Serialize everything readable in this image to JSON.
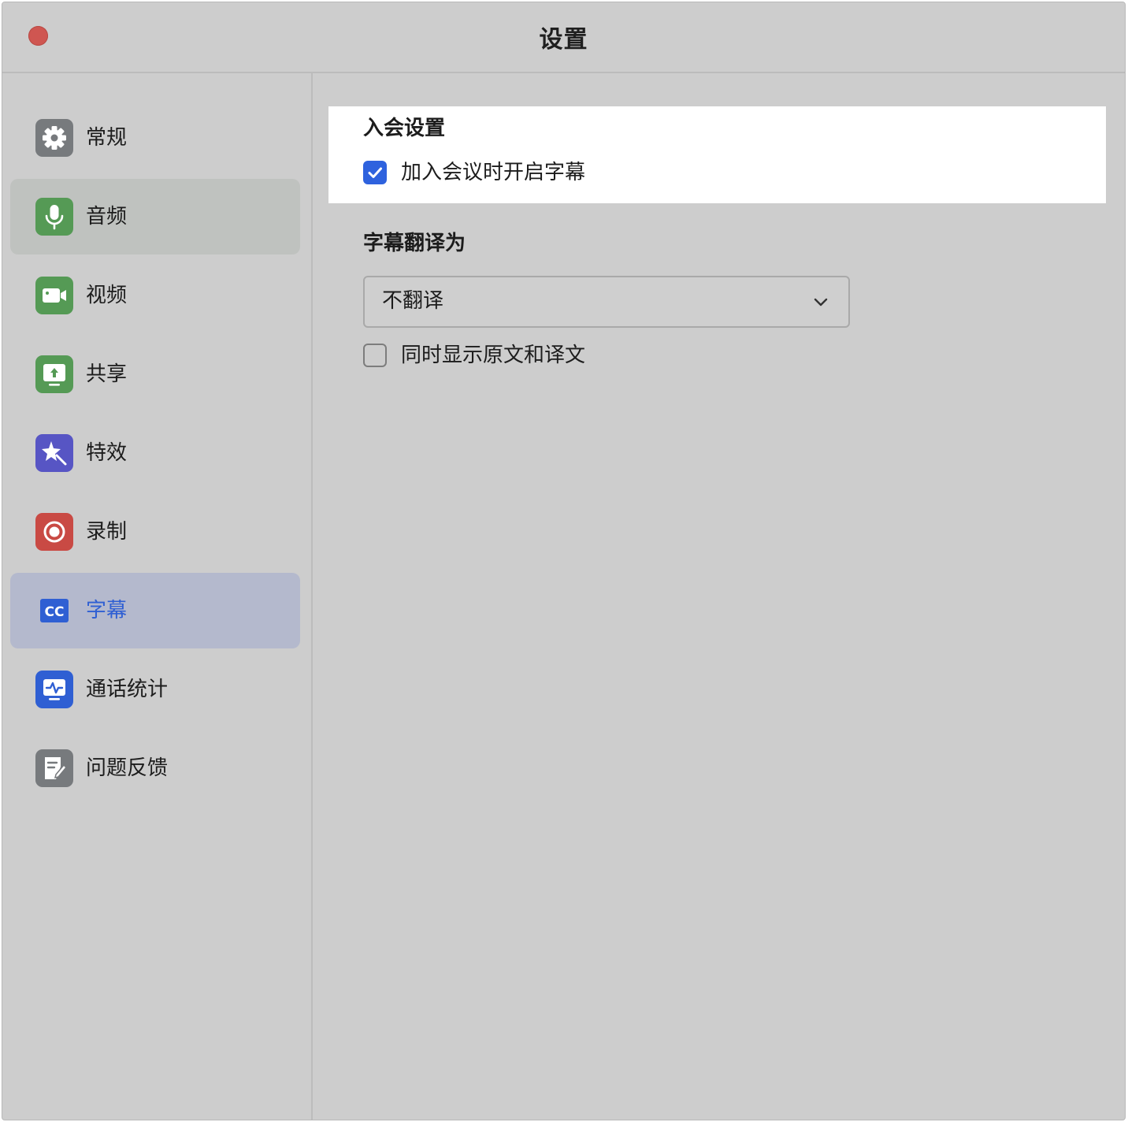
{
  "window": {
    "title": "设置"
  },
  "sidebar": {
    "items": [
      {
        "label": "常规",
        "icon": "gear-icon",
        "color": "#777a7d",
        "state": "normal"
      },
      {
        "label": "音频",
        "icon": "microphone-icon",
        "color": "#559a55",
        "state": "hover"
      },
      {
        "label": "视频",
        "icon": "video-camera-icon",
        "color": "#559a55",
        "state": "normal"
      },
      {
        "label": "共享",
        "icon": "share-screen-icon",
        "color": "#559a55",
        "state": "normal"
      },
      {
        "label": "特效",
        "icon": "effects-sparkle-icon",
        "color": "#5755c4",
        "state": "normal"
      },
      {
        "label": "录制",
        "icon": "record-icon",
        "color": "#c94a44",
        "state": "normal"
      },
      {
        "label": "字幕",
        "icon": "closed-caption-icon",
        "color": "#2f5fd3",
        "state": "active"
      },
      {
        "label": "通话统计",
        "icon": "call-stats-icon",
        "color": "#2f5fd3",
        "state": "normal"
      },
      {
        "label": "问题反馈",
        "icon": "feedback-icon",
        "color": "#777a7d",
        "state": "normal"
      }
    ]
  },
  "captions": {
    "join_section_title": "入会设置",
    "enable_on_join_label": "加入会议时开启字幕",
    "enable_on_join_checked": true,
    "translate_section_title": "字幕翻译为",
    "translate_select_value": "不翻译",
    "show_both_label": "同时显示原文和译文",
    "show_both_checked": false
  },
  "colors": {
    "accent": "#2e62de",
    "close_button": "#cf5651"
  }
}
